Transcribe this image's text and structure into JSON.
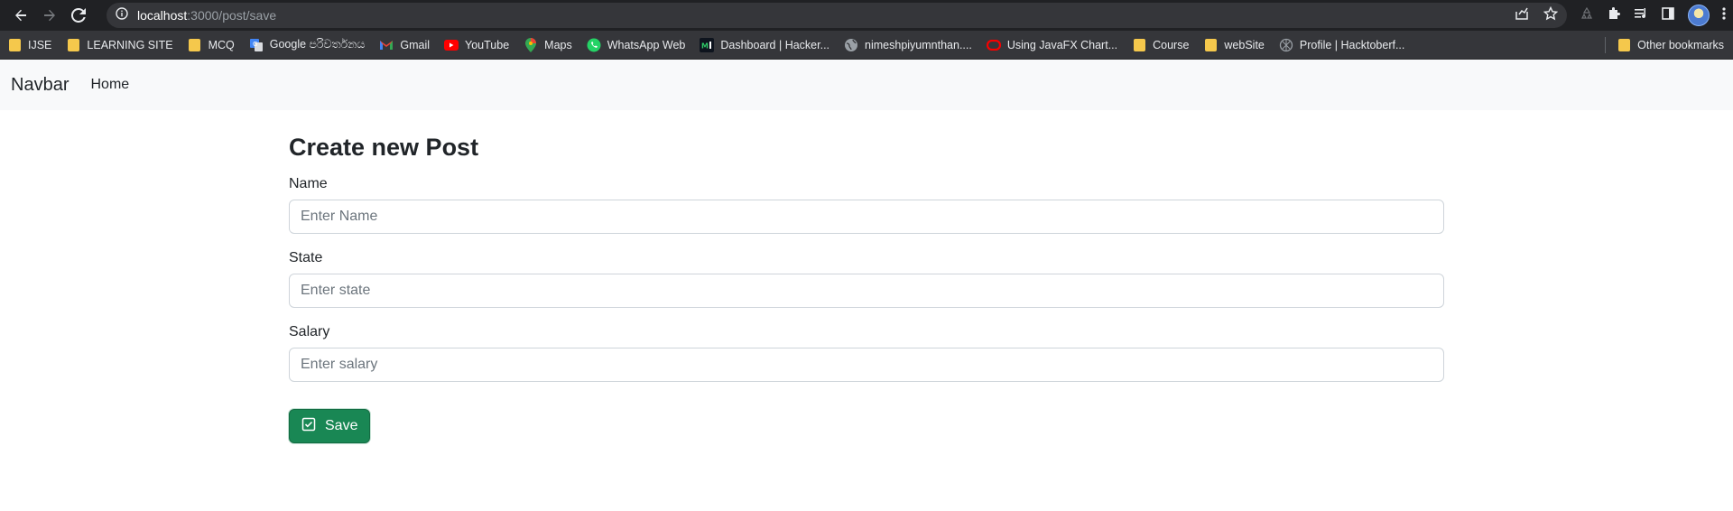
{
  "browser": {
    "url_host": "localhost",
    "url_path": ":3000/post/save",
    "bookmarks": [
      {
        "label": "IJSE",
        "icon": "folder-icon"
      },
      {
        "label": "LEARNING SITE",
        "icon": "folder-icon"
      },
      {
        "label": "MCQ",
        "icon": "folder-icon"
      },
      {
        "label": "Google පරිවර්තනය",
        "icon": "google-translate-icon"
      },
      {
        "label": "Gmail",
        "icon": "gmail-icon"
      },
      {
        "label": "YouTube",
        "icon": "youtube-icon"
      },
      {
        "label": "Maps",
        "icon": "maps-icon"
      },
      {
        "label": "WhatsApp Web",
        "icon": "whatsapp-icon"
      },
      {
        "label": "Dashboard | Hacker...",
        "icon": "hackerrank-icon"
      },
      {
        "label": "nimeshpiyumnthan....",
        "icon": "globe-icon"
      },
      {
        "label": "Using JavaFX Chart...",
        "icon": "oracle-icon"
      },
      {
        "label": "Course",
        "icon": "folder-icon"
      },
      {
        "label": "webSite",
        "icon": "folder-icon"
      },
      {
        "label": "Profile | Hacktoberf...",
        "icon": "hacktoberfest-icon"
      }
    ],
    "other_bookmarks": "Other bookmarks"
  },
  "navbar": {
    "brand": "Navbar",
    "home": "Home"
  },
  "form": {
    "title": "Create new Post",
    "name_label": "Name",
    "name_placeholder": "Enter Name",
    "state_label": "State",
    "state_placeholder": "Enter state",
    "salary_label": "Salary",
    "salary_placeholder": "Enter salary",
    "save_label": "Save"
  },
  "colors": {
    "save_button": "#198754",
    "navbar_bg": "#f8f9fa",
    "chrome_bg": "#202124"
  }
}
